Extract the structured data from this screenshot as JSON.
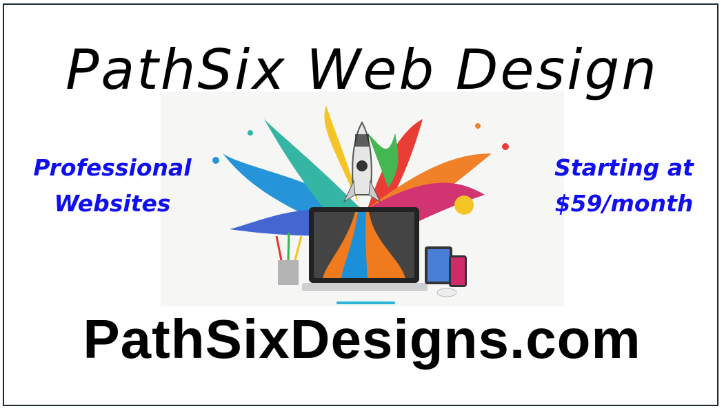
{
  "title": "PathSix Web Design",
  "tagline_left": [
    "Professional",
    "Websites"
  ],
  "tagline_right": [
    "Starting at",
    "$59/month"
  ],
  "url": "PathSixDesigns.com",
  "colors": {
    "accent": "#1010ee",
    "border": "#1c2a36",
    "text": "#000000"
  },
  "illustration": "rocket-launching-from-laptop-with-paint-splash"
}
